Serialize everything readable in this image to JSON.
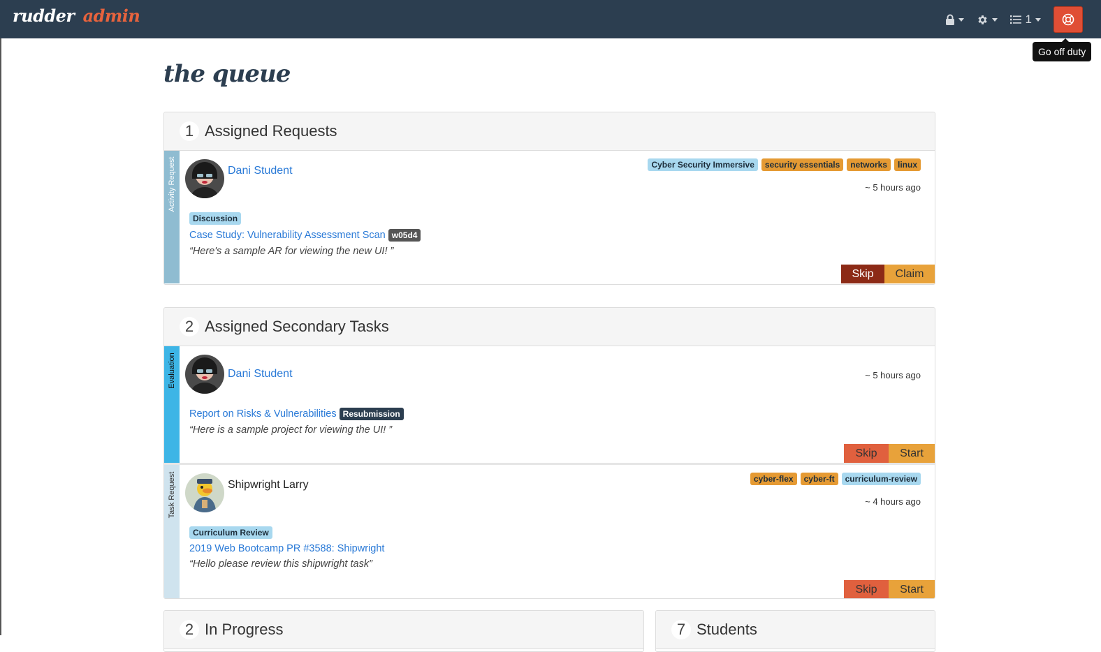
{
  "navbar": {
    "brand": "rudder",
    "brand_suffix": "admin",
    "queue_count": "1",
    "tooltip": "Go off duty"
  },
  "page": {
    "title": "the queue"
  },
  "assigned_requests": {
    "count": "1",
    "title": "Assigned Requests",
    "item": {
      "type": "Activity Request",
      "name": "Dani Student",
      "tags": [
        "Cyber Security Immersive",
        "security essentials",
        "networks",
        "linux"
      ],
      "time": "~ 5 hours ago",
      "category": "Discussion",
      "activity": "Case Study: Vulnerability Assessment Scan",
      "activity_code": "w05d4",
      "quote": "“Here's a sample AR for viewing the new UI! ”",
      "skip": "Skip",
      "claim": "Claim"
    }
  },
  "secondary_tasks": {
    "count": "2",
    "title": "Assigned Secondary Tasks",
    "evaluation": {
      "type": "Evaluation",
      "name": "Dani Student",
      "time": "~ 5 hours ago",
      "project": "Report on Risks & Vulnerabilities",
      "badge": "Resubmission",
      "quote": "“Here is a sample project for viewing the UI! ”",
      "skip": "Skip",
      "start": "Start"
    },
    "task": {
      "type": "Task Request",
      "name": "Shipwright Larry",
      "tags": [
        "cyber-flex",
        "cyber-ft",
        "curriculum-review"
      ],
      "time": "~ 4 hours ago",
      "category": "Curriculum Review",
      "project": "2019 Web Bootcamp PR #3588: Shipwright",
      "quote": "“Hello please review this shipwright task”",
      "skip": "Skip",
      "start": "Start"
    }
  },
  "in_progress": {
    "count": "2",
    "title": "In Progress"
  },
  "students": {
    "count": "7",
    "title": "Students"
  }
}
